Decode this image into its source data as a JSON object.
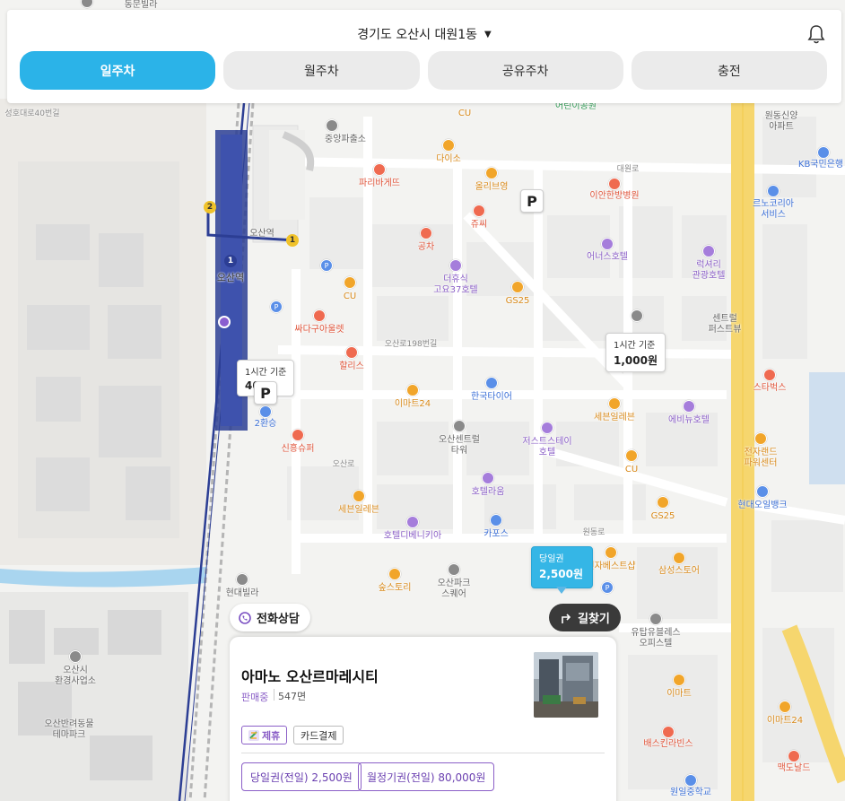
{
  "header": {
    "location": "경기도 오산시 대원1동",
    "tabs": [
      {
        "label": "일주차",
        "active": true
      },
      {
        "label": "월주차",
        "active": false
      },
      {
        "label": "공유주차",
        "active": false
      },
      {
        "label": "충전",
        "active": false
      }
    ]
  },
  "map": {
    "labels": {
      "obanggu": "동문빌라",
      "sangho": "성호대로40번길",
      "jungang": "중앙파출소",
      "daiso": "다이소",
      "paris": "파리바게뜨",
      "olive": "올리브영",
      "juc": "쥬씨",
      "gongcha": "공차",
      "deohyu": "더휴식\n고요37호텔",
      "gs25a": "GS25",
      "cu1": "CU",
      "cu2": "CU",
      "ssada": "싸다구아울렛",
      "hallis": "할리스",
      "emart24a": "이마트24",
      "hankook": "한국타이어",
      "osan_center": "오산센트럴\n타워",
      "jastis": "저스트스테이\n호텔",
      "hotel_rau": "호텔라움",
      "sebin1": "세븐일레븐",
      "sebin2": "세븐일레븐",
      "hotel_denis": "호텔디베니키아",
      "kapos": "카포스",
      "sinheung": "신흥슈퍼",
      "hyundai_villa": "현대빌라",
      "sooptori": "숲스토리",
      "osanpark": "오산파크\n스퀘어",
      "osan_station": "오산역",
      "osan_station2": "오산역",
      "cu_top": "CU",
      "eodin": "어린이공원",
      "wondong": "원동신양\n아파트",
      "kb": "KB국민은행",
      "lenokorea": "르노코리아\n서비스",
      "leeahn": "이안한방병원",
      "onus": "어너스호텔",
      "luxury": "럭셔리\n관광호텔",
      "central_first": "센트럴\n퍼스트뷰",
      "starbucks": "스타벅스",
      "ebinu": "에비뉴호텔",
      "gs25b": "GS25",
      "cu3": "CU",
      "jeonja": "전자랜드\n파워센터",
      "hyundai_oil": "현대오일뱅크",
      "samsung": "삼성스토어",
      "jeonja_best": "전자베스트샵",
      "yutap": "유탑유블레스\n오피스텔",
      "emart": "이마트",
      "baskin": "배스킨라빈스",
      "emart24b": "이마트24",
      "mcd": "맥도날드",
      "wonil": "원일중학교",
      "osan_city": "오산시\n환경사업소",
      "osan_animal": "오산반려동물\n테마파크",
      "two_transfer": "2환승",
      "osan_198": "오산로198번길",
      "daewon_ro": "대원로",
      "wondong_ro": "원동로",
      "gyeonggi": "경기대로",
      "osan_ro": "오산로"
    },
    "bubbles": {
      "b1_top": "1시간 기준",
      "b1_val": "1,000원",
      "b2_top": "1시간 기준",
      "b2_val": "40",
      "b3_top": "당일권",
      "b3_val": "2,500원"
    },
    "parking_letter": "P"
  },
  "actions": {
    "phone": "전화상담",
    "directions": "길찾기"
  },
  "card": {
    "name": "아마노 오산르마레시티",
    "status": "판매중",
    "capacity": "547면",
    "tag_partner": "제휴",
    "tag_card": "카드결제",
    "price_day": "당일권(전일) 2,500원",
    "price_month": "월정기권(전일) 80,000원"
  },
  "colors": {
    "accent": "#2bb3e8",
    "purple": "#8b5fc7",
    "subway": "#2c3e94",
    "road_major": "#f6d66e"
  },
  "icons": [
    "bell-icon",
    "caret-down-icon",
    "phone-icon",
    "turn-right-icon",
    "parking-icon",
    "partner-icon"
  ]
}
